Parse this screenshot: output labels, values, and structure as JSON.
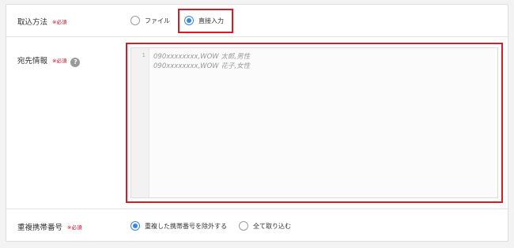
{
  "import_method": {
    "label": "取込方法",
    "required": "※必須",
    "options": [
      {
        "label": "ファイル",
        "checked": false
      },
      {
        "label": "直接入力",
        "checked": true
      }
    ]
  },
  "destination": {
    "label": "宛先情報",
    "required": "※必須",
    "help_icon": "?",
    "editor": {
      "line_numbers": [
        "1"
      ],
      "placeholder_lines": [
        "090xxxxxxxx,WOW 太郎,男性",
        "090xxxxxxxx,WOW 花子,女性"
      ]
    }
  },
  "duplicate_mobile": {
    "label": "重複携帯番号",
    "required": "※必須",
    "options": [
      {
        "label": "重複した携帯番号を除外する",
        "checked": true
      },
      {
        "label": "全て取り込む",
        "checked": false
      }
    ]
  },
  "colors": {
    "accent": "#3a86d9",
    "required_text": "#d0021b",
    "highlight_border": "#d81b24"
  }
}
